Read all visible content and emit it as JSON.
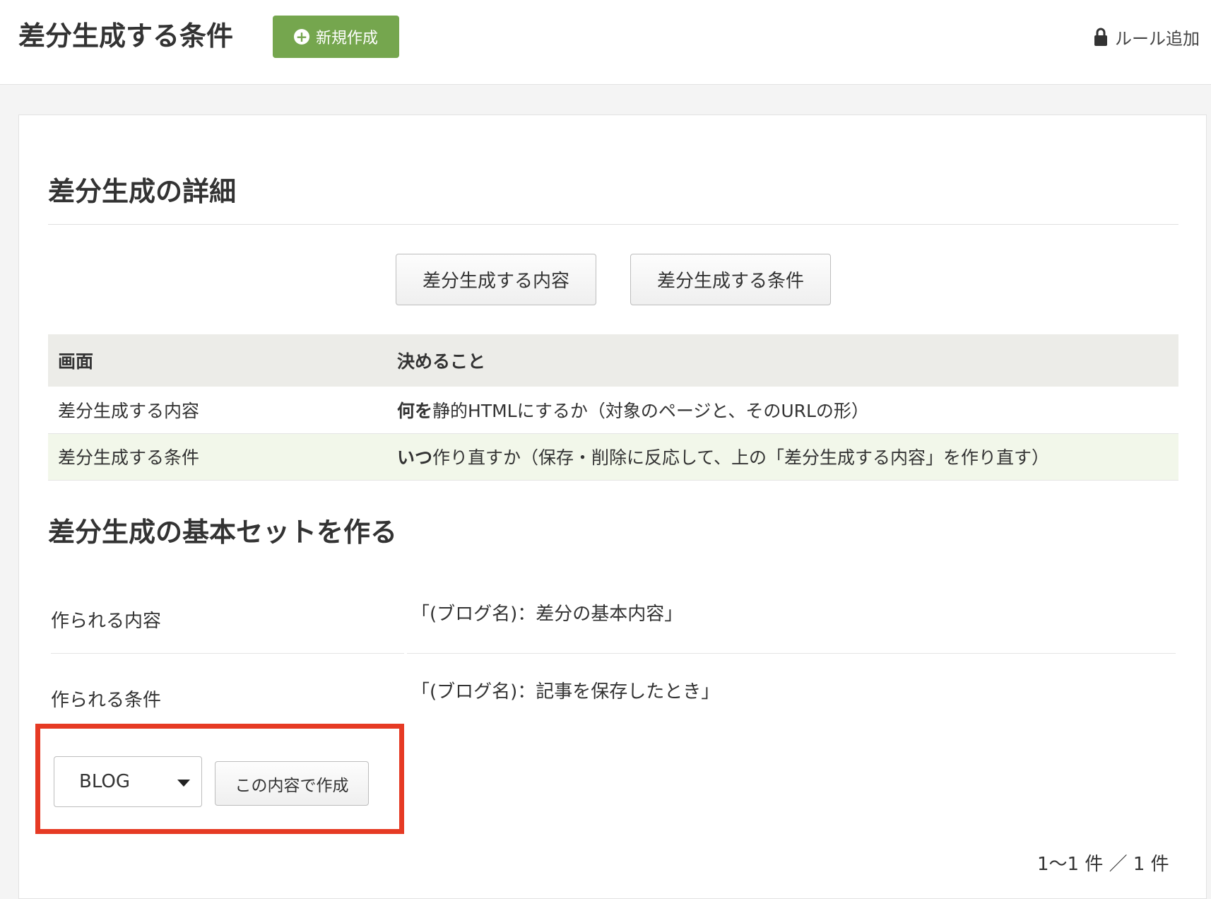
{
  "header": {
    "title": "差分生成する条件",
    "new_button_label": "新規作成",
    "rule_add_label": "ルール追加"
  },
  "details": {
    "title": "差分生成の詳細",
    "tabs": [
      {
        "label": "差分生成する内容"
      },
      {
        "label": "差分生成する条件"
      }
    ],
    "table": {
      "headers": [
        "画面",
        "決めること"
      ],
      "rows": [
        {
          "screen": "差分生成する内容",
          "what_bold": "何を",
          "what_rest": "静的HTMLにするか（対象のページと、そのURLの形）"
        },
        {
          "screen": "差分生成する条件",
          "what_bold": "いつ",
          "what_rest": "作り直すか（保存・削除に反応して、上の「差分生成する内容」を作り直す）"
        }
      ]
    }
  },
  "basic_set": {
    "title": "差分生成の基本セットを作る",
    "content_label": "作られる内容",
    "content_value": "「(ブログ名)：差分の基本内容」",
    "condition_label": "作られる条件",
    "condition_value": "「(ブログ名)：記事を保存したとき」",
    "select_value": "BLOG",
    "create_button_label": "この内容で作成"
  },
  "pagination": {
    "count": "1〜1 件 ／ 1 件"
  },
  "colors": {
    "accent_green": "#75a64e",
    "highlight_red": "#e63a24"
  }
}
